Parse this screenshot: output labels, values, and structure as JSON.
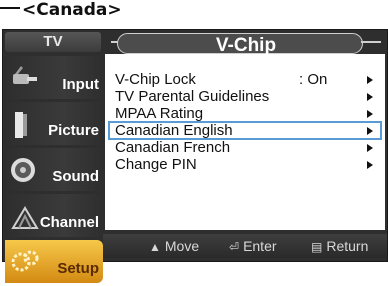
{
  "page_heading": "<Canada>",
  "nav": {
    "header": "TV",
    "items": [
      {
        "label": "Input",
        "icon": "antenna-plug-icon"
      },
      {
        "label": "Picture",
        "icon": "picture-icon"
      },
      {
        "label": "Sound",
        "icon": "speaker-icon"
      },
      {
        "label": "Channel",
        "icon": "satellite-dish-icon"
      },
      {
        "label": "Setup",
        "icon": "gear-icon"
      }
    ],
    "selected": "Setup"
  },
  "menu": {
    "title": "V-Chip",
    "items": [
      {
        "label": "V-Chip Lock",
        "value": ": On",
        "has_arrow": true
      },
      {
        "label": "TV Parental Guidelines",
        "value": "",
        "has_arrow": true
      },
      {
        "label": "MPAA Rating",
        "value": "",
        "has_arrow": true
      },
      {
        "label": "Canadian English",
        "value": "",
        "has_arrow": true
      },
      {
        "label": "Canadian French",
        "value": "",
        "has_arrow": true
      },
      {
        "label": "Change PIN",
        "value": "",
        "has_arrow": true
      }
    ],
    "highlighted": "Canadian English"
  },
  "footer": {
    "move": "Move",
    "move_icon": "updown-arrows-icon",
    "enter": "Enter",
    "enter_icon": "enter-key-icon",
    "return": "Return",
    "return_icon": "menu-return-icon"
  },
  "colors": {
    "selected_gradient_top": "#f6c84a",
    "selected_gradient_bottom": "#d38a12",
    "highlight_outline": "#5b9bd5",
    "osd_background": "#2e2e2e"
  }
}
